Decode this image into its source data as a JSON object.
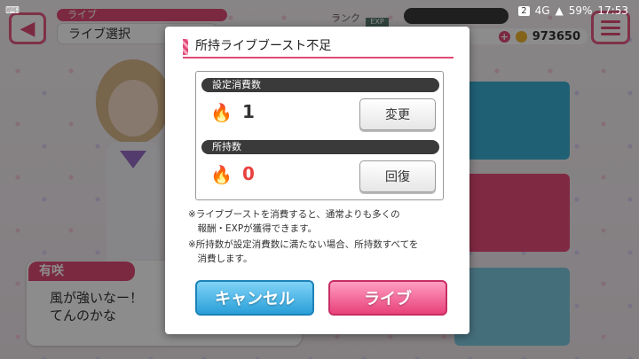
{
  "status_bar": {
    "left_icon": "keyboard-icon",
    "sim_badge": "2",
    "network": "4G",
    "battery": "59%",
    "time": "17:53"
  },
  "header": {
    "tag": "ライブ",
    "title": "ライブ選択",
    "rank_label": "ランク",
    "exp_label": "EXP",
    "coins": "973650"
  },
  "character": {
    "name": "有咲",
    "line": "風が強いなー！\nてんのかな"
  },
  "modal": {
    "title": "所持ライブブースト不足",
    "set_cost_label": "設定消費数",
    "set_cost_value": "1",
    "change_button": "変更",
    "owned_label": "所持数",
    "owned_value": "0",
    "recover_button": "回復",
    "note1": "※ライブブーストを消費すると、通常よりも多くの\n　報酬・EXPが獲得できます。",
    "note2": "※所持数が設定消費数に満たない場合、所持数すべてを\n　消費します。",
    "cancel_button": "キャンセル",
    "live_button": "ライブ"
  },
  "colors": {
    "accent": "#e04b77",
    "cancel": "#2a9fd8",
    "owned_value": "#e8413f"
  }
}
